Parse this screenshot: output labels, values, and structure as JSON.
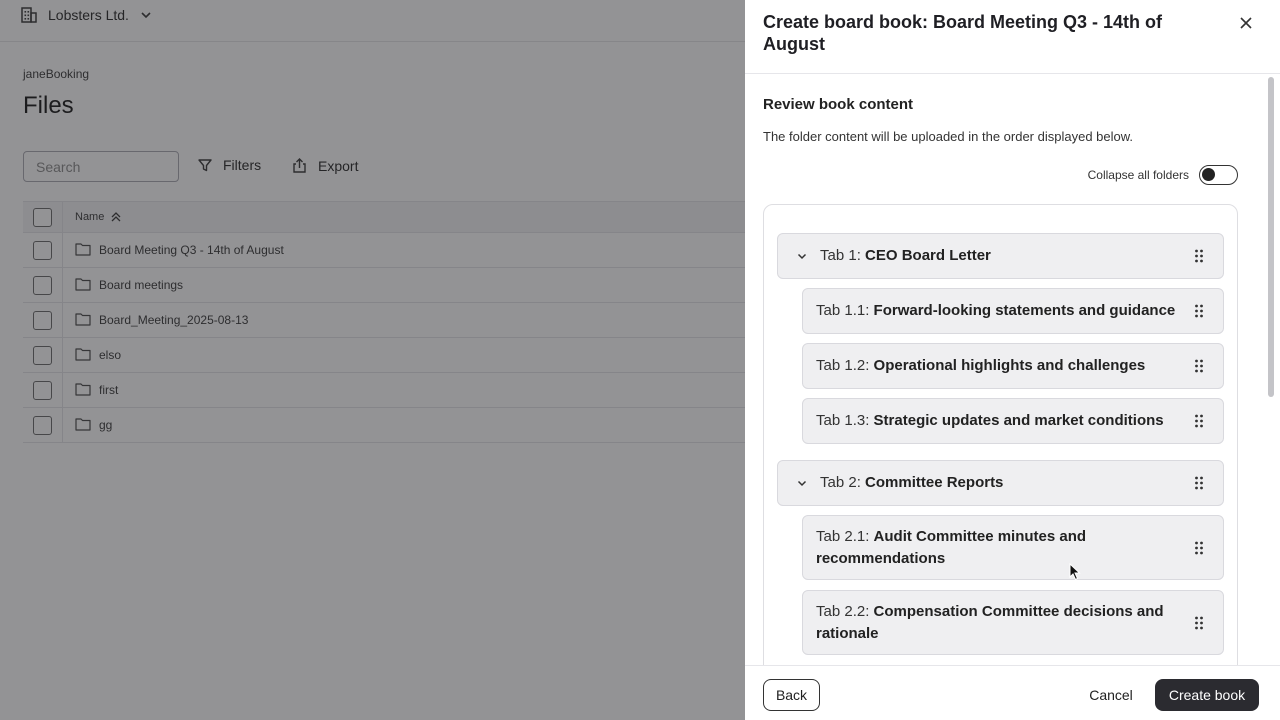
{
  "app": {
    "org_name": "Lobsters Ltd.",
    "breadcrumb": "janeBooking",
    "page_title": "Files"
  },
  "toolbar": {
    "search_placeholder": "Search",
    "filters_label": "Filters",
    "export_label": "Export"
  },
  "table": {
    "column_name": "Name",
    "rows": [
      "Board Meeting Q3 - 14th of August",
      "Board meetings",
      "Board_Meeting_2025-08-13",
      "elso",
      "first",
      "gg"
    ]
  },
  "drawer": {
    "title": "Create board book: Board Meeting Q3 - 14th of August",
    "section_title": "Review book content",
    "section_desc": "The folder content will be uploaded in the order displayed below.",
    "collapse_label": "Collapse all folders",
    "collapse_on": false,
    "items": [
      {
        "prefix": "Tab 1:",
        "text": "CEO Board Letter",
        "level": "tab"
      },
      {
        "prefix": "Tab 1.1:",
        "text": "Forward-looking statements and guidance",
        "level": "sub"
      },
      {
        "prefix": "Tab 1.2:",
        "text": "Operational highlights and challenges",
        "level": "sub"
      },
      {
        "prefix": "Tab 1.3:",
        "text": "Strategic updates and market conditions",
        "level": "sub"
      },
      {
        "prefix": "Tab 2:",
        "text": "Committee Reports",
        "level": "tab"
      },
      {
        "prefix": "Tab 2.1:",
        "text": "Audit Committee minutes and recommendations",
        "level": "sub"
      },
      {
        "prefix": "Tab 2.2:",
        "text": "Compensation Committee decisions and rationale",
        "level": "sub"
      }
    ],
    "footer": {
      "back_label": "Back",
      "cancel_label": "Cancel",
      "create_label": "Create book"
    }
  },
  "icons": {
    "org": "building-icon",
    "org_menu": "chevron-down-icon",
    "filter": "filter-icon",
    "export": "export-icon",
    "sort": "sort-ascending-icon",
    "folder": "folder-icon",
    "close": "close-icon",
    "expand": "chevron-down-icon",
    "drag": "drag-handle-icon"
  }
}
